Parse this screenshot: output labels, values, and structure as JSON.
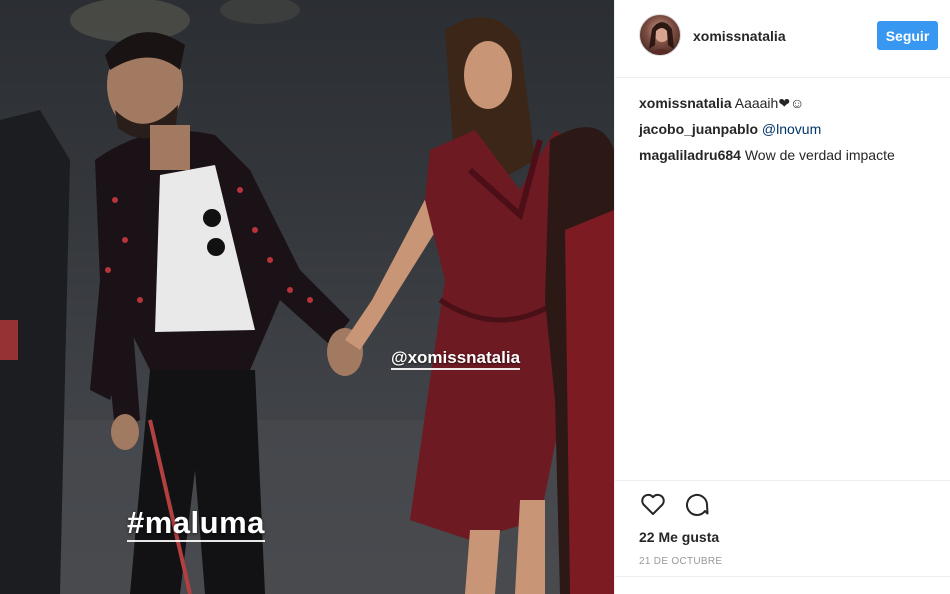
{
  "photo": {
    "sticker_handle": "@xomissnatalia",
    "sticker_hashtag": "#maluma"
  },
  "header": {
    "username": "xomissnatalia",
    "follow_label": "Seguir",
    "follow_color": "#3897f0"
  },
  "comments": [
    {
      "user": "xomissnatalia",
      "text": "Aaaaih❤︎☺"
    },
    {
      "user": "jacobo_juanpablo",
      "mention": "@lnovum"
    },
    {
      "user": "magalilаdru684",
      "text": "Wow de verdad impacte"
    }
  ],
  "actions": {
    "like_icon": "heart-icon",
    "comment_icon": "comment-bubble-icon"
  },
  "likes": "22 Me gusta",
  "date": "21 DE OCTUBRE"
}
